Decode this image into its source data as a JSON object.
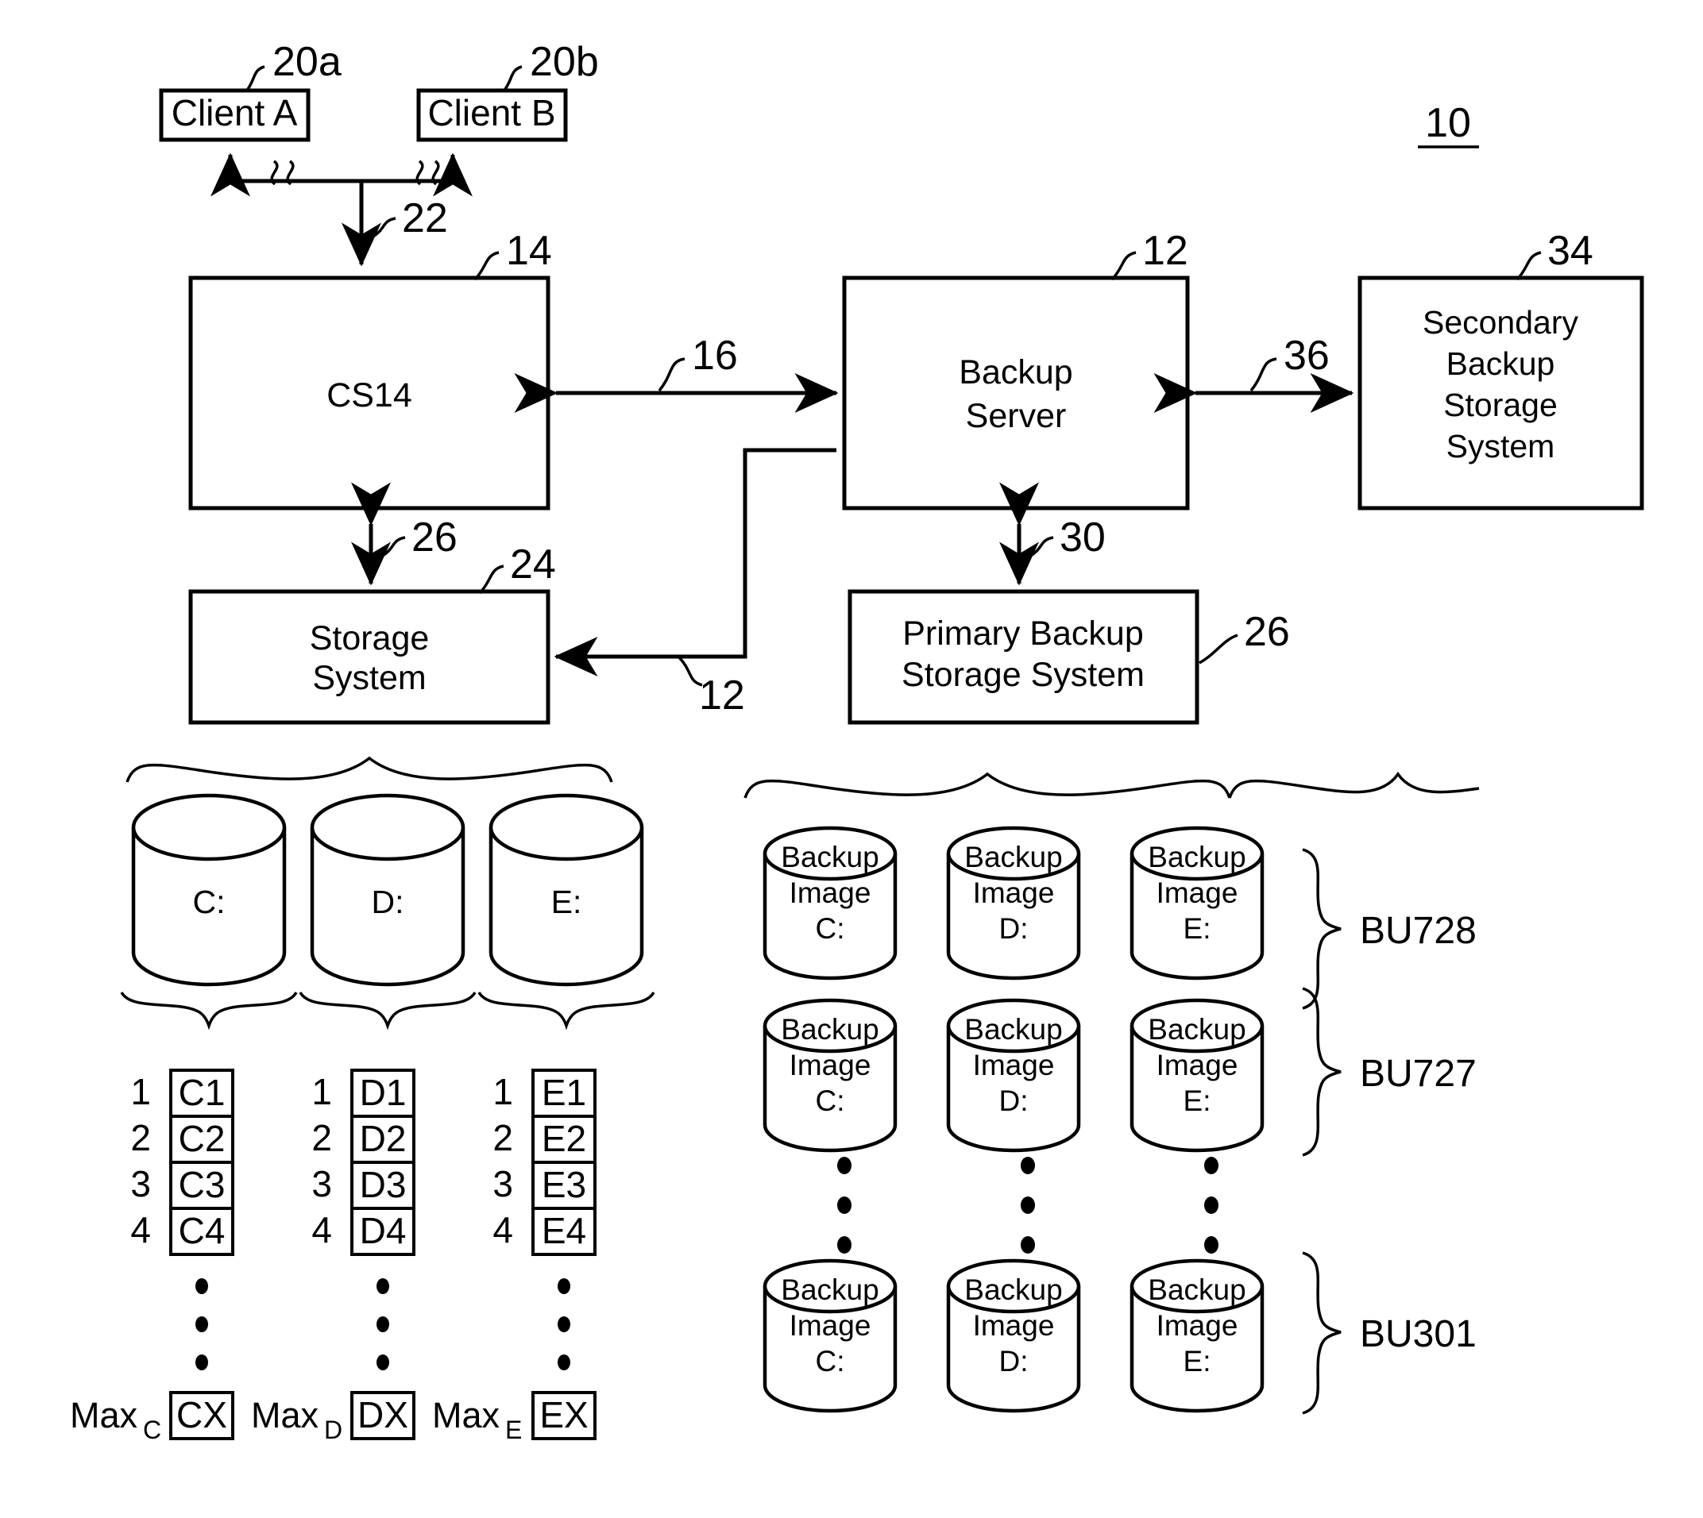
{
  "figure": {
    "ref_label": "10"
  },
  "clients": [
    {
      "label": "Client A",
      "ref": "20a"
    },
    {
      "label": "Client B",
      "ref": "20b"
    }
  ],
  "network": {
    "ref": "22"
  },
  "blocks": {
    "cs14": {
      "label": "CS14",
      "ref": "14"
    },
    "backup_server": {
      "line1": "Backup",
      "line2": "Server",
      "ref": "12"
    },
    "secondary": {
      "line1": "Secondary",
      "line2": "Backup",
      "line3": "Storage",
      "line4": "System",
      "ref": "34"
    },
    "storage_system": {
      "line1": "Storage",
      "line2": "System",
      "ref": "24"
    },
    "primary_backup": {
      "line1": "Primary Backup",
      "line2": "Storage System",
      "ref": "26"
    }
  },
  "links": {
    "cs14_backup_server": "16",
    "backup_server_secondary": "36",
    "cs14_storage": "26",
    "backup_server_primary": "30",
    "backup_to_storage": "12"
  },
  "volumes": [
    {
      "label": "C:",
      "blocks": [
        {
          "index": "1",
          "name": "C1"
        },
        {
          "index": "2",
          "name": "C2"
        },
        {
          "index": "3",
          "name": "C3"
        },
        {
          "index": "4",
          "name": "C4"
        }
      ],
      "max_label": "Max",
      "max_sub": "C",
      "max_block": "CX"
    },
    {
      "label": "D:",
      "blocks": [
        {
          "index": "1",
          "name": "D1"
        },
        {
          "index": "2",
          "name": "D2"
        },
        {
          "index": "3",
          "name": "D3"
        },
        {
          "index": "4",
          "name": "D4"
        }
      ],
      "max_label": "Max",
      "max_sub": "D",
      "max_block": "DX"
    },
    {
      "label": "E:",
      "blocks": [
        {
          "index": "1",
          "name": "E1"
        },
        {
          "index": "2",
          "name": "E2"
        },
        {
          "index": "3",
          "name": "E3"
        },
        {
          "index": "4",
          "name": "E4"
        }
      ],
      "max_label": "Max",
      "max_sub": "E",
      "max_block": "EX"
    }
  ],
  "backup_sets": [
    {
      "name": "BU728",
      "images": [
        {
          "line1": "Backup",
          "line2": "Image",
          "line3": "C:"
        },
        {
          "line1": "Backup",
          "line2": "Image",
          "line3": "D:"
        },
        {
          "line1": "Backup",
          "line2": "Image",
          "line3": "E:"
        }
      ]
    },
    {
      "name": "BU727",
      "images": [
        {
          "line1": "Backup",
          "line2": "Image",
          "line3": "C:"
        },
        {
          "line1": "Backup",
          "line2": "Image",
          "line3": "D:"
        },
        {
          "line1": "Backup",
          "line2": "Image",
          "line3": "E:"
        }
      ]
    },
    {
      "name": "BU301",
      "images": [
        {
          "line1": "Backup",
          "line2": "Image",
          "line3": "C:"
        },
        {
          "line1": "Backup",
          "line2": "Image",
          "line3": "D:"
        },
        {
          "line1": "Backup",
          "line2": "Image",
          "line3": "E:"
        }
      ]
    }
  ]
}
